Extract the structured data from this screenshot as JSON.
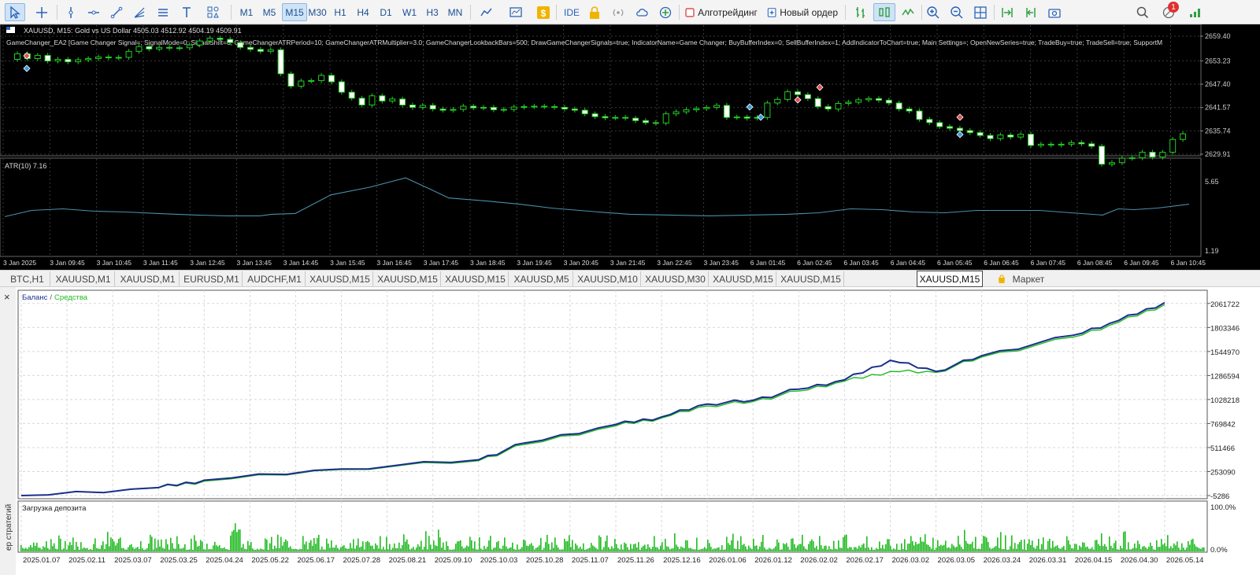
{
  "toolbar": {
    "timeframes": [
      "M1",
      "M5",
      "M15",
      "M30",
      "H1",
      "H4",
      "D1",
      "W1",
      "H3",
      "MN"
    ],
    "active_timeframe": "M15",
    "ide_label": "IDE",
    "algotrading_label": "Алготрейдинг",
    "new_order_label": "Новый ордер",
    "notification_count": "1",
    "icons": [
      "cursor-icon",
      "crosshair-icon",
      "vertical-line-icon",
      "horizontal-line-icon",
      "trend-line-icon",
      "fibo-fan-icon",
      "channel-icon",
      "text-icon",
      "shapes-icon",
      "chart-type-icon",
      "template-icon",
      "dollar-icon",
      "lock-icon",
      "signals-icon",
      "cloud-icon",
      "vps-icon",
      "stop-square-icon",
      "new-order-icon",
      "bar-chart-icon",
      "candles-icon",
      "line-chart-icon",
      "zoom-in-icon",
      "zoom-out-icon",
      "grid-icon",
      "autoscroll-icon",
      "shift-icon",
      "screenshot-icon",
      "search-icon",
      "alert-icon",
      "signal-strength-icon"
    ]
  },
  "chart": {
    "symbol_info": "XAUUSD, M15:  Gold vs US Dollar  4505.03 4512.92 4504.19 4509.91",
    "indicator_info": "GameChanger_EA2 [Game Changer Signal=; SignalMode=0; SignalShift=0; GameChangerATRPeriod=10; GameChangerATRMultiplier=3.0; GameChangerLookbackBars=500; DrawGameChangerSignals=true; IndicatorName=Game Changer; BuyBufferIndex=0; SellBufferIndex=1; AddIndicatorToChart=true; Main Settings=; OpenNewSeries=true; TradeBuy=true; TradeSell=true; SupportM",
    "price_ticks": [
      "2659.40",
      "2653.23",
      "2647.40",
      "2641.57",
      "2635.74",
      "2629.91"
    ],
    "atr_label": "ATR(10) 7.16",
    "atr_ticks": [
      "5.65",
      "1.19"
    ],
    "time_ticks": [
      "3 Jan 2025",
      "3 Jan 09:45",
      "3 Jan 10:45",
      "3 Jan 11:45",
      "3 Jan 12:45",
      "3 Jan 13:45",
      "3 Jan 14:45",
      "3 Jan 15:45",
      "3 Jan 16:45",
      "3 Jan 17:45",
      "3 Jan 18:45",
      "3 Jan 19:45",
      "3 Jan 20:45",
      "3 Jan 21:45",
      "3 Jan 22:45",
      "3 Jan 23:45",
      "6 Jan 01:45",
      "6 Jan 02:45",
      "6 Jan 03:45",
      "6 Jan 04:45",
      "6 Jan 05:45",
      "6 Jan 06:45",
      "6 Jan 07:45",
      "6 Jan 08:45",
      "6 Jan 09:45",
      "6 Jan 10:45"
    ],
    "colors": {
      "background": "#000000",
      "grid": "#3a3a3a",
      "bull_body": "#000000",
      "bear_body": "#ffffff",
      "wick": "#22cc22",
      "atr_line": "#4a8fa8",
      "sell_marker": "#e05050",
      "buy_marker": "#3a9ad9"
    }
  },
  "tabs": [
    "BTC,H1",
    "XAUUSD,M1",
    "XAUUSD,M1",
    "EURUSD,M1",
    "AUDCHF,M1",
    "XAUUSD,M15",
    "XAUUSD,M15",
    "XAUUSD,M15",
    "XAUUSD,M5",
    "XAUUSD,M10",
    "XAUUSD,M30",
    "XAUUSD,M15",
    "XAUUSD,M15",
    "XAUUSD,M15"
  ],
  "active_tab": "XAUUSD,M15",
  "market_tab": "Маркет",
  "tester": {
    "legend_balance": "Баланс",
    "legend_separator": "/",
    "legend_equity": "Средства",
    "y_ticks": [
      "2061722",
      "1803346",
      "1544970",
      "1286594",
      "1028218",
      "769842",
      "511466",
      "253090",
      "-5286"
    ],
    "x_ticks": [
      "2025.01.07",
      "2025.02.11",
      "2025.03.07",
      "2025.03.25",
      "2025.04.24",
      "2025.05.22",
      "2025.06.17",
      "2025.07.28",
      "2025.08.21",
      "2025.09.10",
      "2025.10.03",
      "2025.10.28",
      "2025.11.07",
      "2025.11.26",
      "2025.12.16",
      "2026.01.06",
      "2026.01.12",
      "2026.02.02",
      "2026.02.17",
      "2026.03.02",
      "2026.03.05",
      "2026.03.24",
      "2026.03.31",
      "2026.04.15",
      "2026.04.30",
      "2026.05.14"
    ],
    "deposit_label": "Загрузка депозита",
    "deposit_ticks": [
      "100.0%",
      "0.0%"
    ],
    "side_label": "ер стратегий",
    "close_glyph": "×",
    "colors": {
      "balance": "#1a2f8c",
      "equity": "#22bb22",
      "deposit_bars": "#22bb22",
      "grid": "#d8d8d8"
    },
    "chart_data": {
      "type": "line",
      "series": [
        {
          "name": "Баланс",
          "x": [
            "2025.01.07",
            "2025.03.25",
            "2025.04.24",
            "2025.07.28",
            "2025.10.03",
            "2025.10.28",
            "2025.11.26",
            "2025.12.16",
            "2026.01.06",
            "2026.01.12",
            "2026.02.02",
            "2026.02.17",
            "2026.03.02",
            "2026.03.05",
            "2026.03.24",
            "2026.04.15",
            "2026.04.30",
            "2026.05.14"
          ],
          "values": [
            -5286,
            80000,
            160000,
            280000,
            380000,
            560000,
            760000,
            840000,
            980000,
            1020000,
            1140000,
            1240000,
            1450000,
            1330000,
            1500000,
            1720000,
            1880000,
            2070000
          ]
        },
        {
          "name": "Средства",
          "x": [
            "2025.01.07",
            "2025.03.25",
            "2025.04.24",
            "2025.07.28",
            "2025.10.03",
            "2025.10.28",
            "2025.11.26",
            "2025.12.16",
            "2026.01.06",
            "2026.01.12",
            "2026.02.02",
            "2026.02.17",
            "2026.03.02",
            "2026.03.05",
            "2026.03.24",
            "2026.04.15",
            "2026.04.30",
            "2026.05.14"
          ],
          "values": [
            -5286,
            78000,
            150000,
            275000,
            370000,
            545000,
            745000,
            830000,
            960000,
            1005000,
            1120000,
            1225000,
            1330000,
            1320000,
            1485000,
            1700000,
            1860000,
            2050000
          ]
        }
      ],
      "ylim": [
        -5286,
        2170000
      ]
    }
  }
}
